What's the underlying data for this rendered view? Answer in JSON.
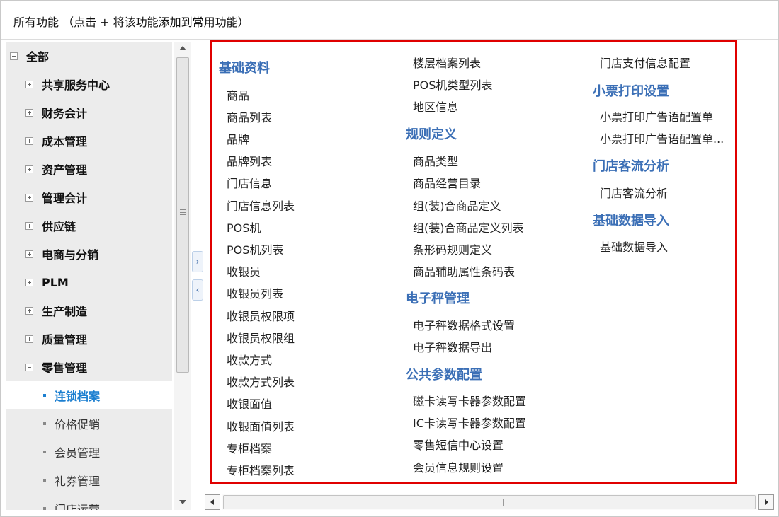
{
  "header": {
    "title": "所有功能  （点击 + 将该功能添加到常用功能）"
  },
  "tree": {
    "root": "全部",
    "modules": [
      "共享服务中心",
      "财务会计",
      "成本管理",
      "资产管理",
      "管理会计",
      "供应链",
      "电商与分销",
      "PLM",
      "生产制造",
      "质量管理",
      "零售管理"
    ],
    "submodules": [
      "连锁档案",
      "价格促销",
      "会员管理",
      "礼券管理",
      "门店运营"
    ],
    "active_submodule": "连锁档案",
    "expanded_module": "零售管理"
  },
  "content": {
    "col1": {
      "heading": "基础资料",
      "items": [
        "商品",
        "商品列表",
        "品牌",
        "品牌列表",
        "门店信息",
        "门店信息列表",
        "POS机",
        "POS机列表",
        "收银员",
        "收银员列表",
        "收银员权限项",
        "收银员权限组",
        "收款方式",
        "收款方式列表",
        "收银面值",
        "收银面值列表",
        "专柜档案",
        "专柜档案列表"
      ]
    },
    "col2": {
      "top_items": [
        "楼层档案列表",
        "POS机类型列表",
        "地区信息"
      ],
      "group1": {
        "heading": "规则定义",
        "items": [
          "商品类型",
          "商品经营目录",
          "组(装)合商品定义",
          "组(装)合商品定义列表",
          "条形码规则定义",
          "商品辅助属性条码表"
        ]
      },
      "group2": {
        "heading": "电子秤管理",
        "items": [
          "电子秤数据格式设置",
          "电子秤数据导出"
        ]
      },
      "group3": {
        "heading": "公共参数配置",
        "items": [
          "磁卡读写卡器参数配置",
          "IC卡读写卡器参数配置",
          "零售短信中心设置",
          "会员信息规则设置"
        ]
      }
    },
    "col3": {
      "top_items": [
        "门店支付信息配置"
      ],
      "group1": {
        "heading": "小票打印设置",
        "items": [
          "小票打印广告语配置单",
          "小票打印广告语配置单..."
        ]
      },
      "group2": {
        "heading": "门店客流分析",
        "items": [
          "门店客流分析"
        ]
      },
      "group3": {
        "heading": "基础数据导入",
        "items": [
          "基础数据导入"
        ]
      }
    }
  },
  "colors": {
    "accent": "#3b6fb6",
    "active": "#1c7fd0",
    "highlight_border": "#e00000"
  },
  "icons": {
    "expand": "plus-box-icon",
    "collapse": "minus-box-icon",
    "scroll_up": "arrow-up-icon",
    "scroll_down": "arrow-down-icon",
    "expand_panel": "chevron-right-icon",
    "collapse_panel": "chevron-left-icon"
  }
}
